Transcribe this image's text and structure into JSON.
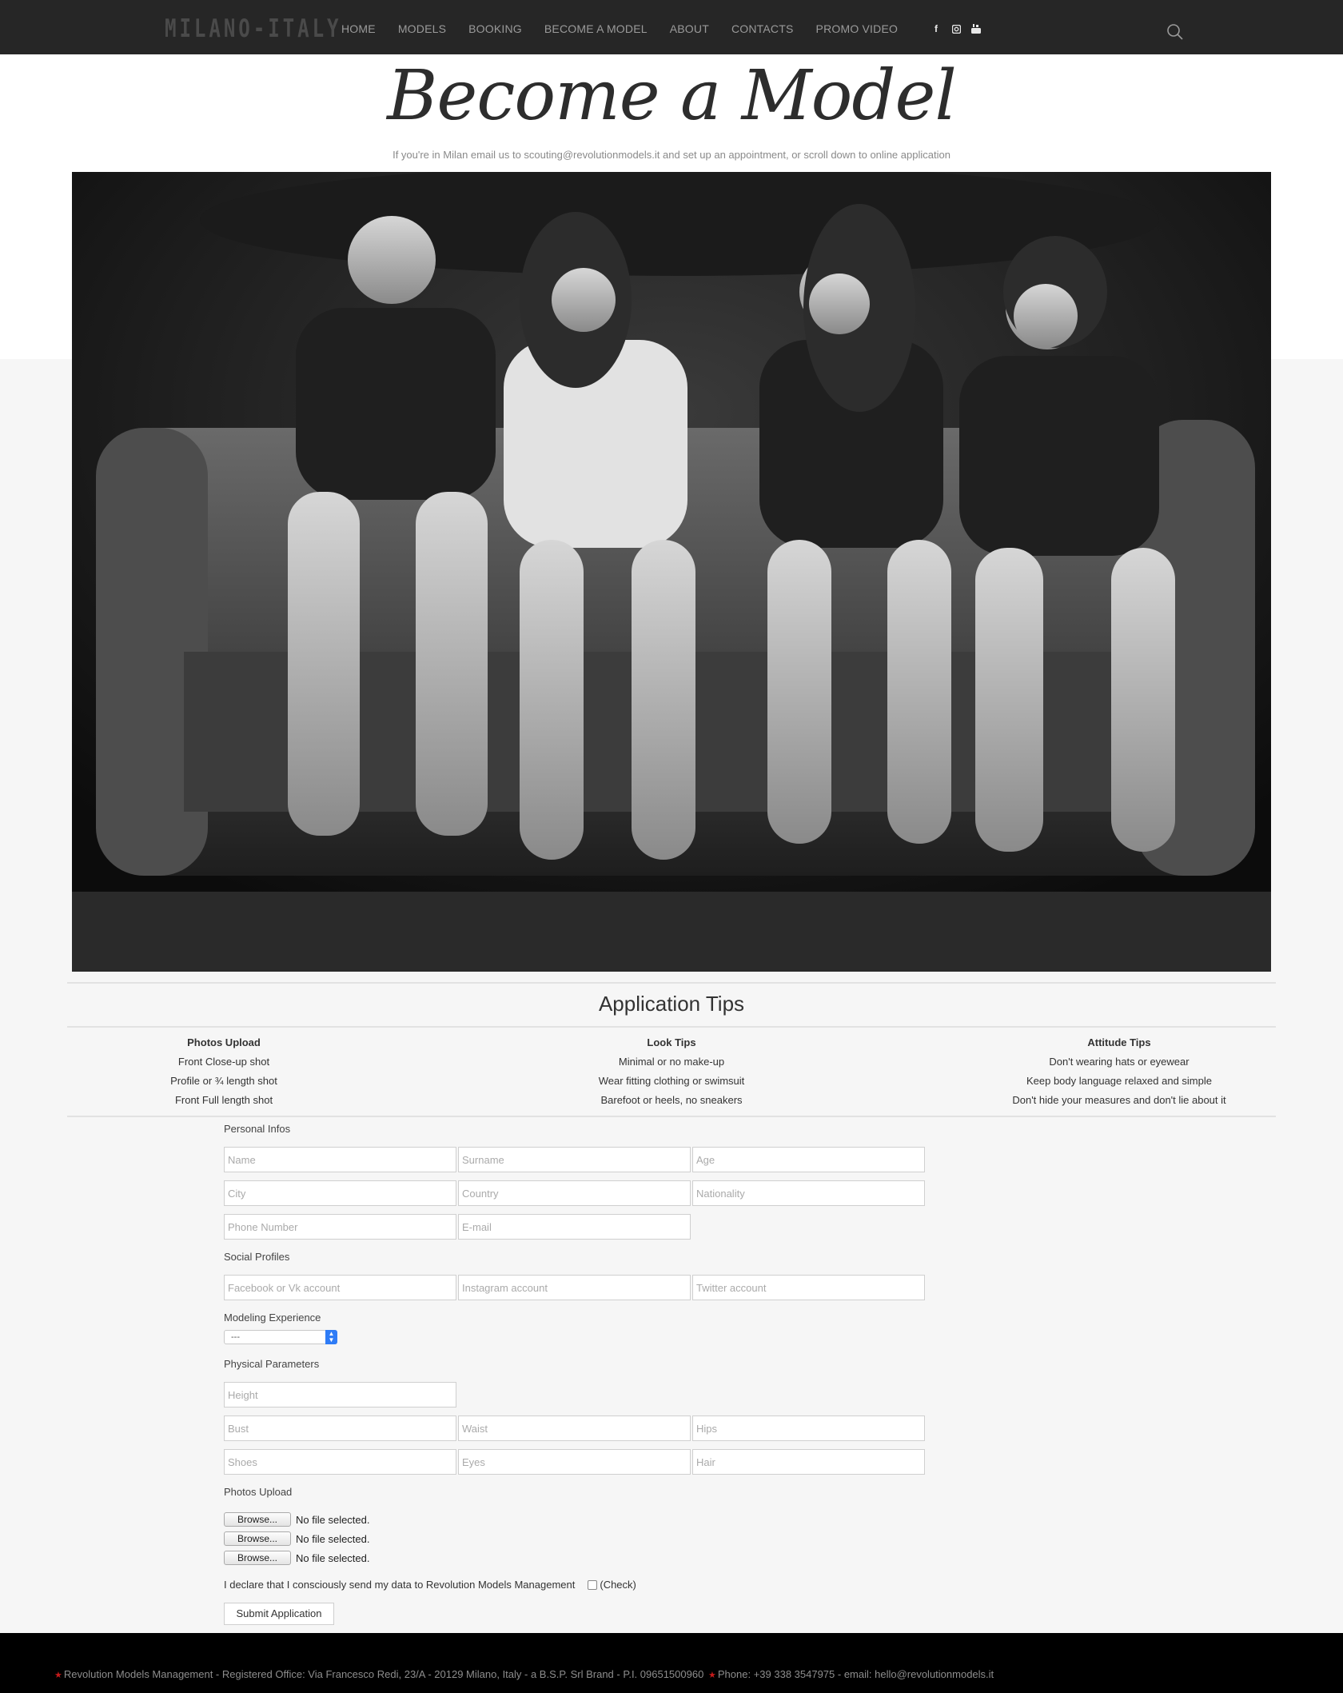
{
  "brand": {
    "logo_text": "MILANO-ITALY"
  },
  "nav": {
    "items": [
      "HOME",
      "MODELS",
      "BOOKING",
      "BECOME A MODEL",
      "ABOUT",
      "CONTACTS",
      "PROMO VIDEO"
    ],
    "social": [
      "facebook-icon",
      "instagram-icon",
      "youtube-icon"
    ]
  },
  "hero": {
    "title": "Become a Model",
    "subtitle": "If you're in Milan email us to scouting@revolutionmodels.it and set up an appointment, or scroll down to online application"
  },
  "tips": {
    "title": "Application Tips",
    "columns": [
      {
        "heading": "Photos Upload",
        "lines": [
          "Front Close-up shot",
          "Profile or ¾ length shot",
          "Front Full length shot"
        ]
      },
      {
        "heading": "Look Tips",
        "lines": [
          "Minimal or no make-up",
          "Wear fitting clothing or swimsuit",
          "Barefoot or heels, no sneakers"
        ]
      },
      {
        "heading": "Attitude Tips",
        "lines": [
          "Don't wearing hats or eyewear",
          "Keep body language relaxed and simple",
          "Don't hide your measures and don't lie about it"
        ]
      }
    ]
  },
  "form": {
    "personal_label": "Personal Infos",
    "personal": {
      "name": "Name",
      "surname": "Surname",
      "age": "Age",
      "city": "City",
      "country": "Country",
      "nationality": "Nationality",
      "phone": "Phone Number",
      "email": "E-mail"
    },
    "social_label": "Social Profiles",
    "social": {
      "facebook": "Facebook or Vk account",
      "instagram": "Instagram account",
      "twitter": "Twitter account"
    },
    "experience_label": "Modeling Experience",
    "experience_selected": "---",
    "physical_label": "Physical Parameters",
    "physical": {
      "height": "Height",
      "bust": "Bust",
      "waist": "Waist",
      "hips": "Hips",
      "shoes": "Shoes",
      "eyes": "Eyes",
      "hair": "Hair"
    },
    "upload_label": "Photos Upload",
    "browse_label": "Browse...",
    "no_file": "No file selected.",
    "declare_text": "I declare that I consciously send my data to Revolution Models Management",
    "check_label": "(Check)",
    "submit_label": "Submit Application"
  },
  "footer": {
    "office": "Revolution Models Management - Registered Office: Via Francesco Redi, 23/A - 20129 Milano, Italy - a B.S.P. Srl Brand - P.I. 09651500960",
    "contact": "Phone: +39 338 3547975 - email: hello@revolutionmodels.it"
  }
}
